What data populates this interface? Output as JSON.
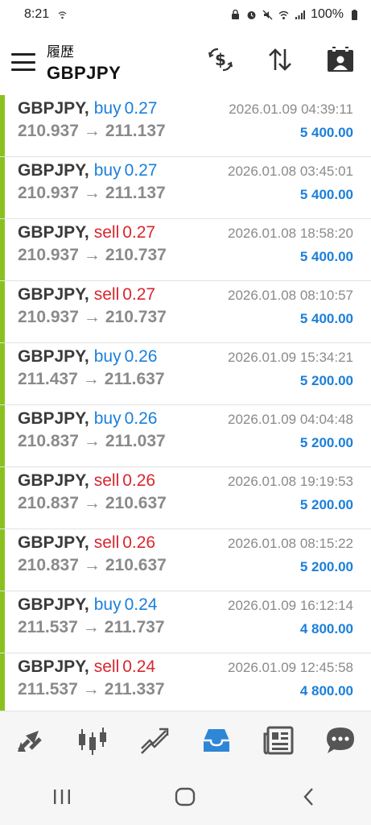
{
  "status": {
    "time": "8:21",
    "battery": "100%"
  },
  "header": {
    "subtitle": "履歴",
    "title": "GBPJPY"
  },
  "rows": [
    {
      "symbol": "GBPJPY,",
      "side": "buy",
      "volume": "0.27",
      "open": "210.937",
      "close": "211.137",
      "time": "2026.01.09 04:39:11",
      "profit": "5 400.00"
    },
    {
      "symbol": "GBPJPY,",
      "side": "buy",
      "volume": "0.27",
      "open": "210.937",
      "close": "211.137",
      "time": "2026.01.08 03:45:01",
      "profit": "5 400.00"
    },
    {
      "symbol": "GBPJPY,",
      "side": "sell",
      "volume": "0.27",
      "open": "210.937",
      "close": "210.737",
      "time": "2026.01.08 18:58:20",
      "profit": "5 400.00"
    },
    {
      "symbol": "GBPJPY,",
      "side": "sell",
      "volume": "0.27",
      "open": "210.937",
      "close": "210.737",
      "time": "2026.01.08 08:10:57",
      "profit": "5 400.00"
    },
    {
      "symbol": "GBPJPY,",
      "side": "buy",
      "volume": "0.26",
      "open": "211.437",
      "close": "211.637",
      "time": "2026.01.09 15:34:21",
      "profit": "5 200.00"
    },
    {
      "symbol": "GBPJPY,",
      "side": "buy",
      "volume": "0.26",
      "open": "210.837",
      "close": "211.037",
      "time": "2026.01.09 04:04:48",
      "profit": "5 200.00"
    },
    {
      "symbol": "GBPJPY,",
      "side": "sell",
      "volume": "0.26",
      "open": "210.837",
      "close": "210.637",
      "time": "2026.01.08 19:19:53",
      "profit": "5 200.00"
    },
    {
      "symbol": "GBPJPY,",
      "side": "sell",
      "volume": "0.26",
      "open": "210.837",
      "close": "210.637",
      "time": "2026.01.08 08:15:22",
      "profit": "5 200.00"
    },
    {
      "symbol": "GBPJPY,",
      "side": "buy",
      "volume": "0.24",
      "open": "211.537",
      "close": "211.737",
      "time": "2026.01.09 16:12:14",
      "profit": "4 800.00"
    },
    {
      "symbol": "GBPJPY,",
      "side": "sell",
      "volume": "0.24",
      "open": "211.537",
      "close": "211.337",
      "time": "2026.01.09 12:45:58",
      "profit": "4 800.00"
    }
  ],
  "arrow_glyph": "→",
  "colors": {
    "buy": "#1b7fd9",
    "sell": "#d9262e",
    "accent_bar": "#8bc11f",
    "active_nav": "#2e86d6"
  },
  "bottom_nav": [
    "quotes-icon",
    "chart-icon",
    "trade-icon",
    "history-icon",
    "news-icon",
    "chat-icon"
  ]
}
